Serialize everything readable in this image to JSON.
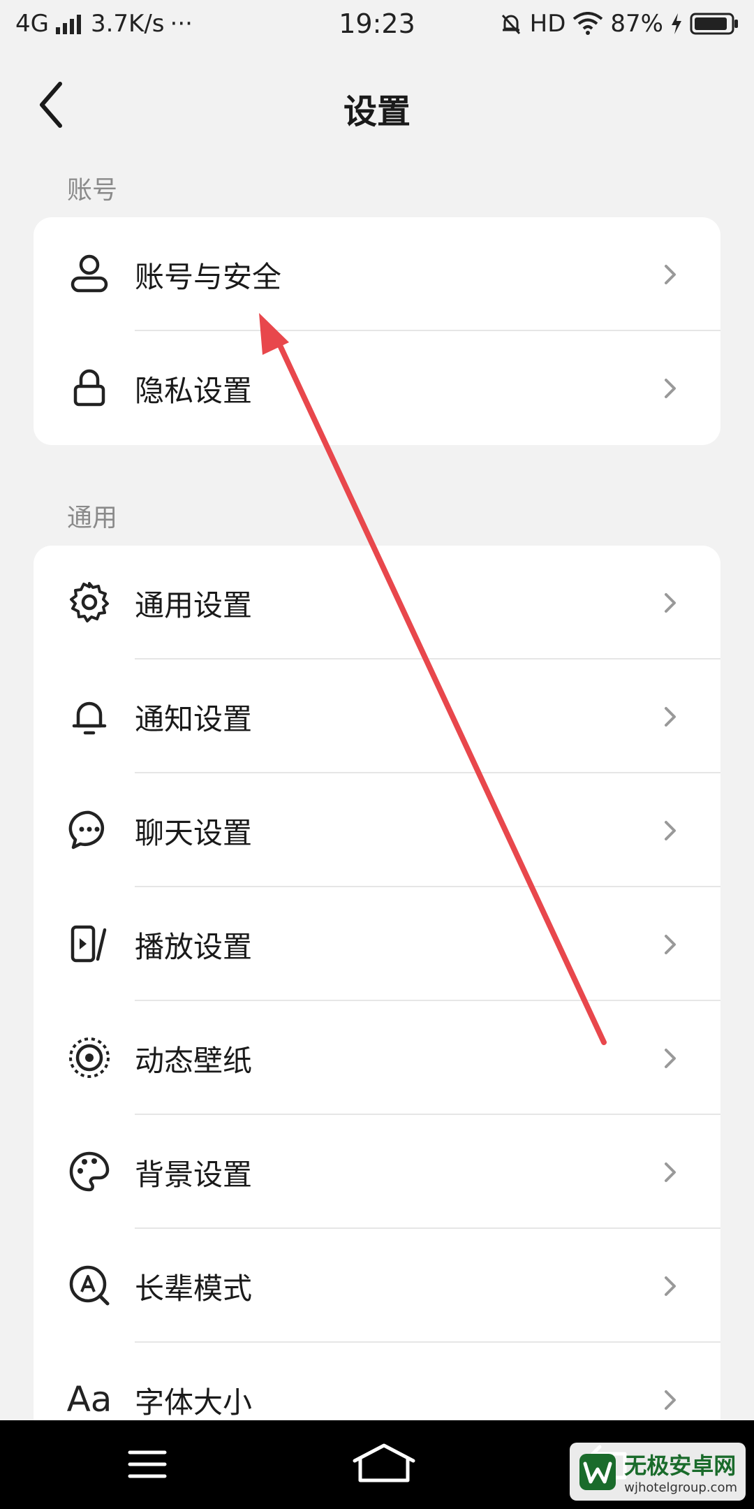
{
  "status_bar": {
    "network": "4G",
    "speed": "3.7K/s",
    "dots": "···",
    "time": "19:23",
    "hd": "HD",
    "battery_percent": "87%"
  },
  "header": {
    "title": "设置"
  },
  "sections": {
    "account": {
      "label": "账号",
      "items": [
        {
          "label": "账号与安全",
          "icon": "user-icon"
        },
        {
          "label": "隐私设置",
          "icon": "lock-icon"
        }
      ]
    },
    "general": {
      "label": "通用",
      "items": [
        {
          "label": "通用设置",
          "icon": "gear-icon"
        },
        {
          "label": "通知设置",
          "icon": "bell-icon"
        },
        {
          "label": "聊天设置",
          "icon": "chat-icon"
        },
        {
          "label": "播放设置",
          "icon": "play-icon"
        },
        {
          "label": "动态壁纸",
          "icon": "wallpaper-icon"
        },
        {
          "label": "背景设置",
          "icon": "palette-icon"
        },
        {
          "label": "长辈模式",
          "icon": "elder-mode-icon"
        },
        {
          "label": "字体大小",
          "icon": "font-size-icon"
        }
      ]
    }
  },
  "font_icon_text": "Aa",
  "watermark": {
    "title": "无极安卓网",
    "url": "wjhotelgroup.com"
  },
  "colors": {
    "background": "#f2f2f2",
    "annotation_arrow": "#e8474c",
    "watermark_green": "#1a6b2b"
  }
}
